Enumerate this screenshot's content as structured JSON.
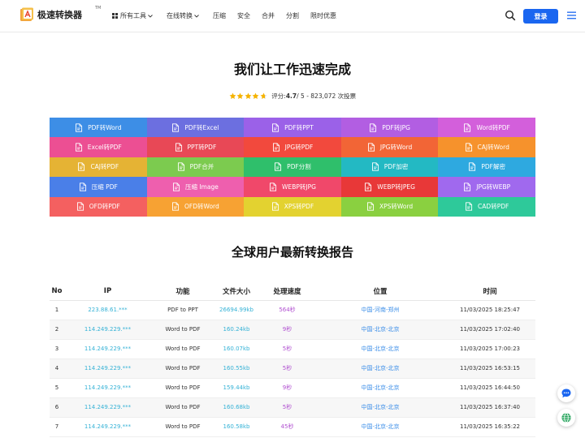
{
  "header": {
    "logo_text": "极速转换器",
    "logo_tm": "TM",
    "nav": [
      {
        "label": "所有工具",
        "grid_icon": true,
        "dropdown": true
      },
      {
        "label": "在线转换",
        "grid_icon": false,
        "dropdown": true
      },
      {
        "label": "压缩",
        "grid_icon": false,
        "dropdown": false
      },
      {
        "label": "安全",
        "grid_icon": false,
        "dropdown": false
      },
      {
        "label": "合并",
        "grid_icon": false,
        "dropdown": false
      },
      {
        "label": "分割",
        "grid_icon": false,
        "dropdown": false
      },
      {
        "label": "限时优惠",
        "grid_icon": false,
        "dropdown": false
      }
    ],
    "login_label": "登录"
  },
  "hero": {
    "title": "我们让工作迅速完成",
    "rating_prefix": "评分: ",
    "rating_value": "4.7",
    "rating_suffix": " / 5 - 823,072 次投票",
    "stars": 4.7
  },
  "tools": [
    {
      "label": "PDF转Word",
      "color": "#3d8ee6"
    },
    {
      "label": "PDF转Excel",
      "color": "#6c6fe0"
    },
    {
      "label": "PDF转PPT",
      "color": "#9b61e8"
    },
    {
      "label": "PDF转JPG",
      "color": "#b25ee2"
    },
    {
      "label": "Word转PDF",
      "color": "#d35fdb"
    },
    {
      "label": "Excel转PDF",
      "color": "#ec4f93"
    },
    {
      "label": "PPT转PDF",
      "color": "#e84856"
    },
    {
      "label": "JPG转PDF",
      "color": "#f2493d"
    },
    {
      "label": "JPG转Word",
      "color": "#f26536"
    },
    {
      "label": "CAJ转Word",
      "color": "#f6922c"
    },
    {
      "label": "CAJ转PDF",
      "color": "#e5b334"
    },
    {
      "label": "PDF合并",
      "color": "#7ccb4f"
    },
    {
      "label": "PDF分割",
      "color": "#2fbf6b"
    },
    {
      "label": "PDF加密",
      "color": "#23b9c3"
    },
    {
      "label": "PDF解密",
      "color": "#2ea9e0"
    },
    {
      "label": "压缩 PDF",
      "color": "#4a7fe8"
    },
    {
      "label": "压缩 Image",
      "color": "#ee5fae"
    },
    {
      "label": "WEBP转JPG",
      "color": "#f0486a"
    },
    {
      "label": "WEBP转JPEG",
      "color": "#e83838"
    },
    {
      "label": "JPG转WEBP",
      "color": "#a069ee"
    },
    {
      "label": "OFD转PDF",
      "color": "#f46060"
    },
    {
      "label": "OFD转Word",
      "color": "#f7a233"
    },
    {
      "label": "XPS转PDF",
      "color": "#e3d230"
    },
    {
      "label": "XPS转Word",
      "color": "#8ad040"
    },
    {
      "label": "CAD转PDF",
      "color": "#2ec99a"
    }
  ],
  "report": {
    "title": "全球用户最新转换报告",
    "columns": [
      "No",
      "IP",
      "功能",
      "文件大小",
      "处理速度",
      "位置",
      "时间"
    ],
    "rows": [
      {
        "no": "1",
        "ip": "223.88.61.***",
        "func": "PDF to PPT",
        "size": "26694.99kb",
        "speed": "564秒",
        "loc": "中国-河南-郑州",
        "time": "11/03/2025 18:25:47"
      },
      {
        "no": "2",
        "ip": "114.249.229.***",
        "func": "Word to PDF",
        "size": "160.24kb",
        "speed": "9秒",
        "loc": "中国-北京-北京",
        "time": "11/03/2025 17:02:40"
      },
      {
        "no": "3",
        "ip": "114.249.229.***",
        "func": "Word to PDF",
        "size": "160.07kb",
        "speed": "5秒",
        "loc": "中国-北京-北京",
        "time": "11/03/2025 17:00:23"
      },
      {
        "no": "4",
        "ip": "114.249.229.***",
        "func": "Word to PDF",
        "size": "160.55kb",
        "speed": "5秒",
        "loc": "中国-北京-北京",
        "time": "11/03/2025 16:53:15"
      },
      {
        "no": "5",
        "ip": "114.249.229.***",
        "func": "Word to PDF",
        "size": "159.44kb",
        "speed": "9秒",
        "loc": "中国-北京-北京",
        "time": "11/03/2025 16:44:50"
      },
      {
        "no": "6",
        "ip": "114.249.229.***",
        "func": "Word to PDF",
        "size": "160.68kb",
        "speed": "5秒",
        "loc": "中国-北京-北京",
        "time": "11/03/2025 16:37:40"
      },
      {
        "no": "7",
        "ip": "114.249.229.***",
        "func": "Word to PDF",
        "size": "160.58kb",
        "speed": "45秒",
        "loc": "中国-北京-北京",
        "time": "11/03/2025 16:35:22"
      }
    ]
  },
  "float_buttons": [
    {
      "icon": "chat-icon"
    },
    {
      "icon": "globe-icon"
    }
  ]
}
